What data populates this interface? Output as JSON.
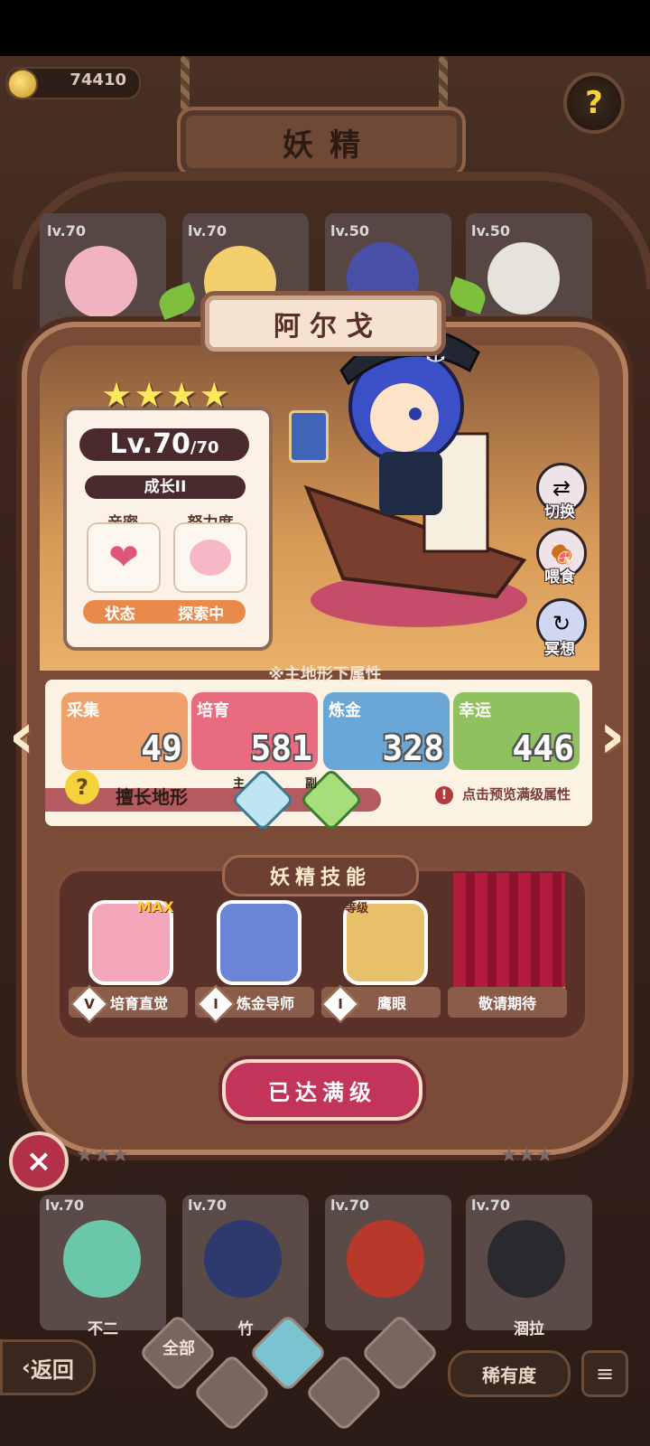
{
  "header": {
    "coin_value": "74410",
    "title": "妖精",
    "help_icon": "question-mark-icon"
  },
  "top_cards": [
    {
      "level": "lv.70"
    },
    {
      "level": "lv.70"
    },
    {
      "level": "lv.50"
    },
    {
      "level": "lv.50"
    }
  ],
  "fairy": {
    "name": "阿尔戈",
    "stars": 4,
    "level": "Lv.70",
    "level_max": "/70",
    "growth": "成长II",
    "intimacy_label": "亲密",
    "effort_label": "努力度",
    "status_label": "状态",
    "status_value": "探索中"
  },
  "side_actions": [
    {
      "label": "切换",
      "icon": "switch-icon"
    },
    {
      "label": "喂食",
      "icon": "meat-icon"
    },
    {
      "label": "冥想",
      "icon": "meditate-icon"
    }
  ],
  "attributes": {
    "title": "※主地形下属性",
    "items": [
      {
        "label": "采集",
        "value": "49",
        "color": "#f0a06a"
      },
      {
        "label": "培育",
        "value": "581",
        "color": "#e96b7f"
      },
      {
        "label": "炼金",
        "value": "328",
        "color": "#6aa6d6"
      },
      {
        "label": "幸运",
        "value": "446",
        "color": "#8fc25e"
      }
    ],
    "terrain_label": "擅长地形",
    "main_tag": "主",
    "sub_tag": "副",
    "preview_hint": "点击预览满级属性"
  },
  "skills": {
    "title": "妖精技能",
    "items": [
      {
        "label": "培育直觉",
        "badge": "V",
        "tag": "MAX"
      },
      {
        "label": "炼金导师",
        "badge": "I",
        "tag": ""
      },
      {
        "label": "鹰眼",
        "badge": "I",
        "tag": "等级"
      },
      {
        "label": "敬请期待",
        "badge": "",
        "tag": ""
      }
    ],
    "maxed_button": "已达满级"
  },
  "bottom_cards": [
    {
      "level": "lv.70",
      "name": "不二"
    },
    {
      "level": "lv.70",
      "name": "竹"
    },
    {
      "level": "lv.70",
      "name": ""
    },
    {
      "level": "lv.70",
      "name": "涸拉"
    }
  ],
  "footer": {
    "back_label": "返回",
    "all_label": "全部",
    "rarity_label": "稀有度",
    "sort_icon": "sort-list-icon"
  },
  "colors": {
    "panel": "#7a4b36",
    "accent_button": "#c2345a",
    "star": "#ffe75a"
  }
}
